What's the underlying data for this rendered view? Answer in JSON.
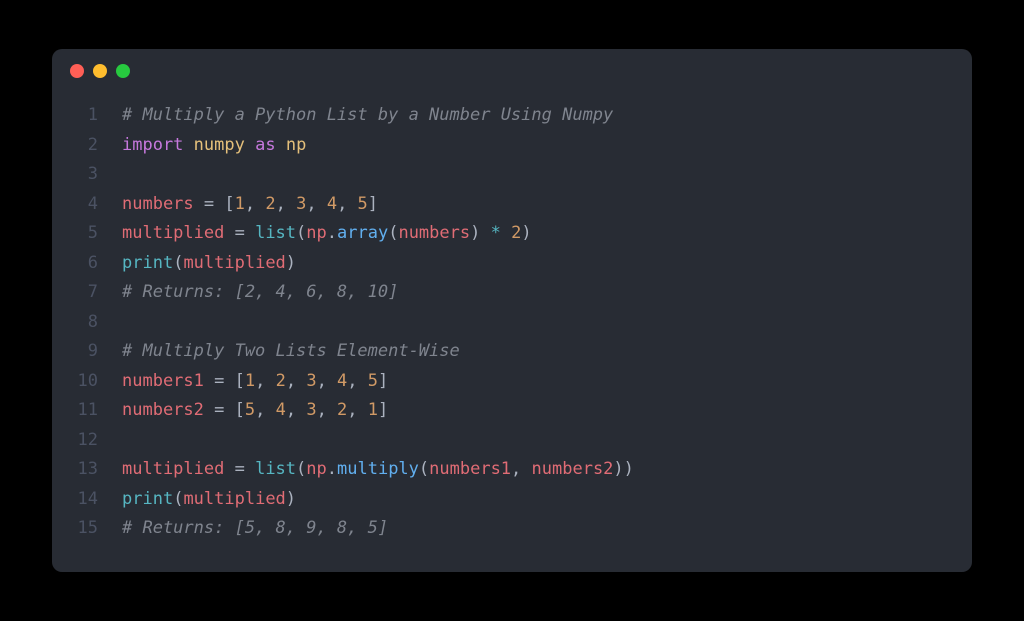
{
  "window": {
    "dots": [
      "red",
      "yellow",
      "green"
    ]
  },
  "colors": {
    "comment": "#7f848e",
    "keyword": "#c678dd",
    "module": "#e5c07b",
    "ident": "#e06c75",
    "func": "#61afef",
    "builtin": "#56b6c2",
    "num": "#d19a66",
    "punct": "#abb2bf",
    "op": "#56b6c2",
    "bg": "#282c34",
    "lineno": "#4b5263"
  },
  "code": {
    "lines": [
      {
        "n": 1,
        "tokens": [
          {
            "t": "# Multiply a Python List by a Number Using Numpy",
            "c": "comment"
          }
        ]
      },
      {
        "n": 2,
        "tokens": [
          {
            "t": "import",
            "c": "keyword"
          },
          {
            "t": " ",
            "c": "punct"
          },
          {
            "t": "numpy",
            "c": "module"
          },
          {
            "t": " ",
            "c": "punct"
          },
          {
            "t": "as",
            "c": "keyword"
          },
          {
            "t": " ",
            "c": "punct"
          },
          {
            "t": "np",
            "c": "module"
          }
        ]
      },
      {
        "n": 3,
        "tokens": []
      },
      {
        "n": 4,
        "tokens": [
          {
            "t": "numbers",
            "c": "ident"
          },
          {
            "t": " = [",
            "c": "punct"
          },
          {
            "t": "1",
            "c": "num"
          },
          {
            "t": ", ",
            "c": "punct"
          },
          {
            "t": "2",
            "c": "num"
          },
          {
            "t": ", ",
            "c": "punct"
          },
          {
            "t": "3",
            "c": "num"
          },
          {
            "t": ", ",
            "c": "punct"
          },
          {
            "t": "4",
            "c": "num"
          },
          {
            "t": ", ",
            "c": "punct"
          },
          {
            "t": "5",
            "c": "num"
          },
          {
            "t": "]",
            "c": "punct"
          }
        ]
      },
      {
        "n": 5,
        "tokens": [
          {
            "t": "multiplied",
            "c": "ident"
          },
          {
            "t": " = ",
            "c": "punct"
          },
          {
            "t": "list",
            "c": "builtin"
          },
          {
            "t": "(",
            "c": "punct"
          },
          {
            "t": "np",
            "c": "ident"
          },
          {
            "t": ".",
            "c": "punct"
          },
          {
            "t": "array",
            "c": "func"
          },
          {
            "t": "(",
            "c": "punct"
          },
          {
            "t": "numbers",
            "c": "ident"
          },
          {
            "t": ") ",
            "c": "punct"
          },
          {
            "t": "*",
            "c": "op"
          },
          {
            "t": " ",
            "c": "punct"
          },
          {
            "t": "2",
            "c": "num"
          },
          {
            "t": ")",
            "c": "punct"
          }
        ]
      },
      {
        "n": 6,
        "tokens": [
          {
            "t": "print",
            "c": "builtin"
          },
          {
            "t": "(",
            "c": "punct"
          },
          {
            "t": "multiplied",
            "c": "ident"
          },
          {
            "t": ")",
            "c": "punct"
          }
        ]
      },
      {
        "n": 7,
        "tokens": [
          {
            "t": "# Returns: [2, 4, 6, 8, 10]",
            "c": "comment"
          }
        ]
      },
      {
        "n": 8,
        "tokens": []
      },
      {
        "n": 9,
        "tokens": [
          {
            "t": "# Multiply Two Lists Element-Wise",
            "c": "comment"
          }
        ]
      },
      {
        "n": 10,
        "tokens": [
          {
            "t": "numbers1",
            "c": "ident"
          },
          {
            "t": " = [",
            "c": "punct"
          },
          {
            "t": "1",
            "c": "num"
          },
          {
            "t": ", ",
            "c": "punct"
          },
          {
            "t": "2",
            "c": "num"
          },
          {
            "t": ", ",
            "c": "punct"
          },
          {
            "t": "3",
            "c": "num"
          },
          {
            "t": ", ",
            "c": "punct"
          },
          {
            "t": "4",
            "c": "num"
          },
          {
            "t": ", ",
            "c": "punct"
          },
          {
            "t": "5",
            "c": "num"
          },
          {
            "t": "]",
            "c": "punct"
          }
        ]
      },
      {
        "n": 11,
        "tokens": [
          {
            "t": "numbers2",
            "c": "ident"
          },
          {
            "t": " = [",
            "c": "punct"
          },
          {
            "t": "5",
            "c": "num"
          },
          {
            "t": ", ",
            "c": "punct"
          },
          {
            "t": "4",
            "c": "num"
          },
          {
            "t": ", ",
            "c": "punct"
          },
          {
            "t": "3",
            "c": "num"
          },
          {
            "t": ", ",
            "c": "punct"
          },
          {
            "t": "2",
            "c": "num"
          },
          {
            "t": ", ",
            "c": "punct"
          },
          {
            "t": "1",
            "c": "num"
          },
          {
            "t": "]",
            "c": "punct"
          }
        ]
      },
      {
        "n": 12,
        "tokens": []
      },
      {
        "n": 13,
        "tokens": [
          {
            "t": "multiplied",
            "c": "ident"
          },
          {
            "t": " = ",
            "c": "punct"
          },
          {
            "t": "list",
            "c": "builtin"
          },
          {
            "t": "(",
            "c": "punct"
          },
          {
            "t": "np",
            "c": "ident"
          },
          {
            "t": ".",
            "c": "punct"
          },
          {
            "t": "multiply",
            "c": "func"
          },
          {
            "t": "(",
            "c": "punct"
          },
          {
            "t": "numbers1",
            "c": "ident"
          },
          {
            "t": ", ",
            "c": "punct"
          },
          {
            "t": "numbers2",
            "c": "ident"
          },
          {
            "t": "))",
            "c": "punct"
          }
        ]
      },
      {
        "n": 14,
        "tokens": [
          {
            "t": "print",
            "c": "builtin"
          },
          {
            "t": "(",
            "c": "punct"
          },
          {
            "t": "multiplied",
            "c": "ident"
          },
          {
            "t": ")",
            "c": "punct"
          }
        ]
      },
      {
        "n": 15,
        "tokens": [
          {
            "t": "# Returns: [5, 8, 9, 8, 5]",
            "c": "comment"
          }
        ]
      }
    ]
  }
}
